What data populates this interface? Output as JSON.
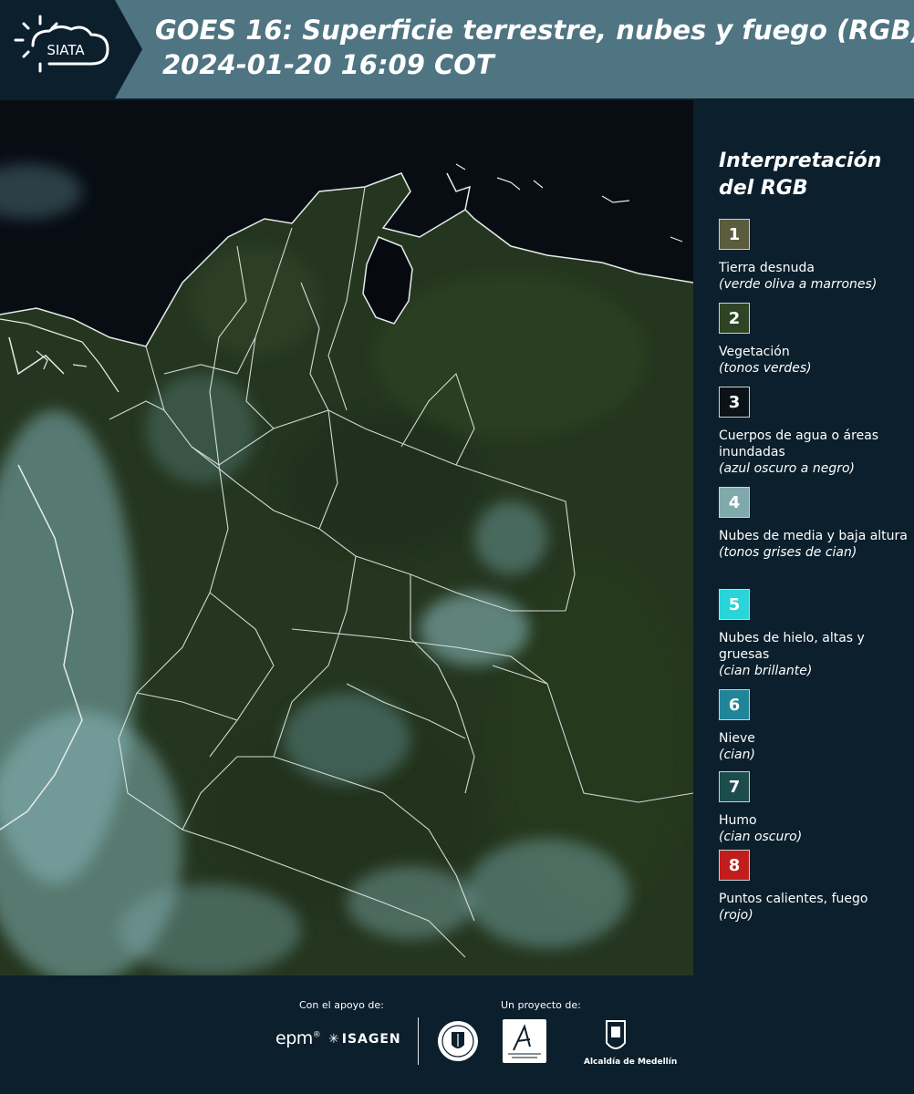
{
  "header": {
    "logo_text": "SIATA",
    "title_line1": "GOES 16: Superficie terrestre, nubes y fuego (RGB)",
    "title_line2": "2024-01-20 16:09 COT"
  },
  "legend": {
    "title": "Interpretación del RGB",
    "items": [
      {
        "number": "1",
        "color": "#5b5c3e",
        "desc": "Tierra desnuda",
        "note": "(verde oliva a marrones)"
      },
      {
        "number": "2",
        "color": "#2f4424",
        "desc": "Vegetación",
        "note": "(tonos verdes)"
      },
      {
        "number": "3",
        "color": "#0b1318",
        "desc": "Cuerpos de agua o áreas inundadas",
        "note": "(azul oscuro a negro)"
      },
      {
        "number": "4",
        "color": "#7fa9ab",
        "desc": "Nubes de media y baja altura",
        "note": "(tonos grises de cian)"
      },
      {
        "number": "5",
        "color": "#29d5d8",
        "desc": "Nubes de hielo, altas y gruesas",
        "note": "(cian brillante)"
      },
      {
        "number": "6",
        "color": "#218599",
        "desc": "Nieve",
        "note": "(cian)"
      },
      {
        "number": "7",
        "color": "#1d4c4c",
        "desc": "Humo",
        "note": "(cian oscuro)"
      },
      {
        "number": "8",
        "color": "#c21d1d",
        "desc": "Puntos calientes, fuego",
        "note": "(rojo)"
      }
    ]
  },
  "footer": {
    "support_label": "Con el apoyo de:",
    "project_label": "Un proyecto de:",
    "epm": "epm",
    "isagen": "ISAGEN",
    "alcaldia": "Alcaldía de Medellín"
  },
  "colors": {
    "header_bg": "#4f7482",
    "logo_bg": "#0b1f2c",
    "page_bg": "#0b1f2c",
    "ocean": "#080d14",
    "land": "#24361f",
    "cloud": "#7fb0b4",
    "border_line": "#e6eaea"
  }
}
